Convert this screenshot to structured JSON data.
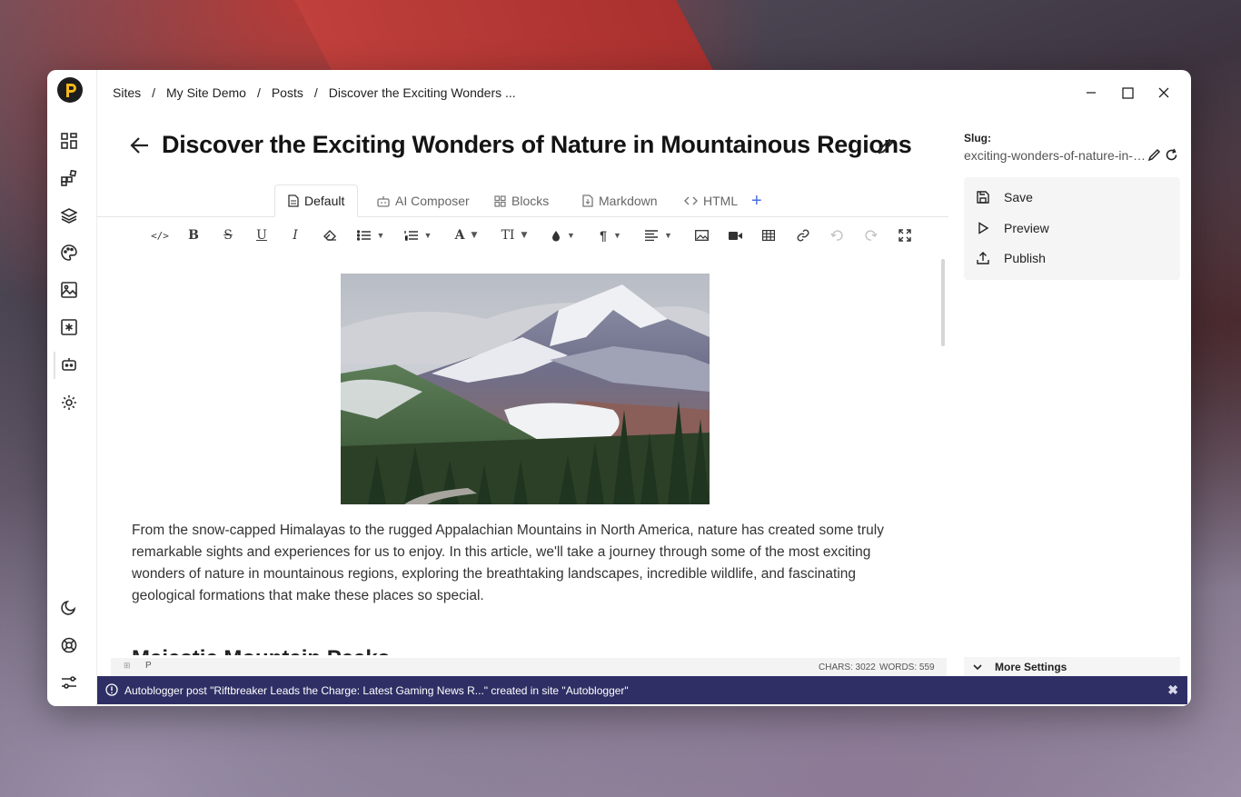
{
  "breadcrumb": [
    "Sites",
    "My Site Demo",
    "Posts",
    "Discover the Exciting Wonders ..."
  ],
  "breadcrumb_separator": "/",
  "post": {
    "title": "Discover the Exciting Wonders of Nature in Mountainous Regions",
    "paragraph": "From the snow-capped Himalayas to the rugged Appalachian Mountains in North America, nature has created some truly remarkable sights and experiences for us to enjoy. In this article, we'll take a journey through some of the most exciting wonders of nature in mountainous regions, exploring the breathtaking landscapes, incredible wildlife, and fascinating geological formations that make these places so special.",
    "heading": "Majestic Mountain Peaks"
  },
  "tabs": [
    {
      "label": "Default",
      "icon": "document-icon",
      "active": true
    },
    {
      "label": "AI Composer",
      "icon": "robot-icon",
      "active": false
    },
    {
      "label": "Blocks",
      "icon": "blocks-icon",
      "active": false
    },
    {
      "label": "Markdown",
      "icon": "markdown-icon",
      "active": false
    },
    {
      "label": "HTML",
      "icon": "code-icon",
      "active": false
    }
  ],
  "tab_add": "+",
  "toolbar": {
    "code": "</>",
    "bold": "B",
    "strike": "S",
    "underline": "U",
    "italic": "I",
    "font": "A",
    "text_size": "TI",
    "paragraph": "¶"
  },
  "statusbar": {
    "element": "P",
    "chars": "CHARS: 3022",
    "words": "WORDS: 559"
  },
  "panel": {
    "slug_label": "Slug:",
    "slug_value": "exciting-wonders-of-nature-in-mountainous-regions",
    "actions": {
      "save": "Save",
      "preview": "Preview",
      "publish": "Publish"
    },
    "more_settings": "More Settings"
  },
  "toast": {
    "text": "Autoblogger post \"Riftbreaker Leads the Charge: Latest Gaming News R...\" created in site \"Autoblogger\"",
    "close": "✖"
  },
  "colors": {
    "toast_bg": "#2f2f66",
    "accent": "#4a6de0",
    "logo_yellow": "#f5b81c"
  }
}
